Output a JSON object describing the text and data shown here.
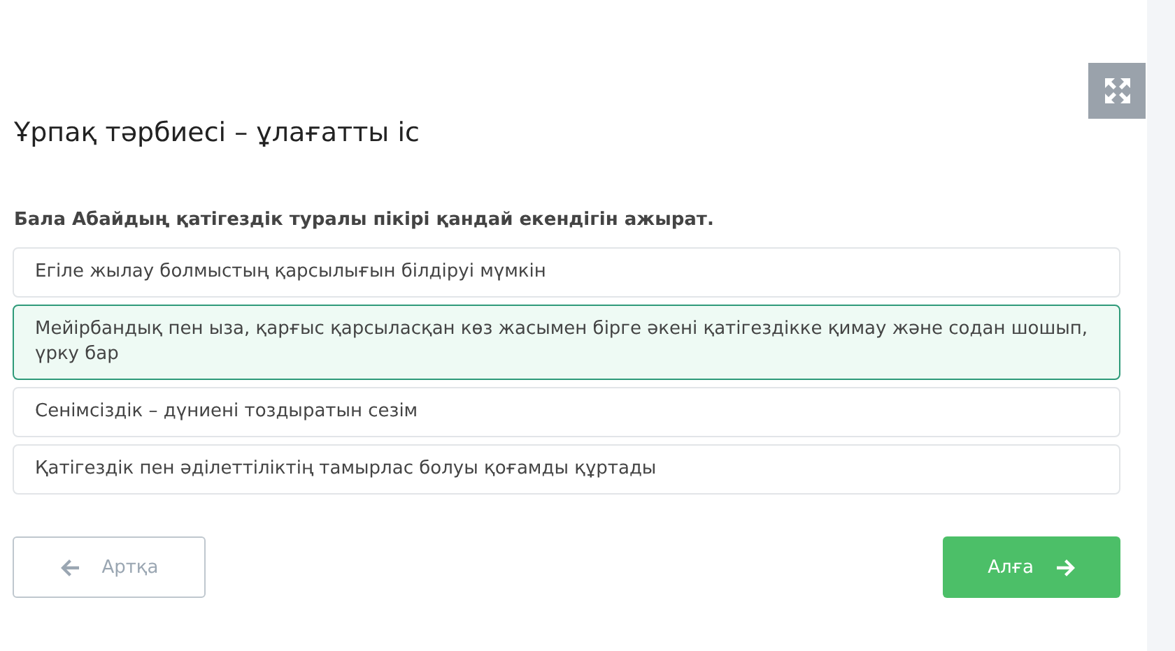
{
  "title": "Ұрпақ тәрбиесі – ұлағатты іс",
  "question": "Бала Абайдың қатігездік туралы пікірі қандай екендігін ажырат.",
  "options": [
    {
      "text": "Егіле жылау болмыстың қарсылығын білдіруі мүмкін",
      "selected": false
    },
    {
      "text": "Мейірбандық пен ыза, қарғыс қарсыласқан көз жасымен бірге әкені қатігездікке қимау және содан шошып, үрку бар",
      "selected": true
    },
    {
      "text": "Сенімсіздік – дүниені тоздыратын сезім",
      "selected": false
    },
    {
      "text": "Қатігездік пен әділеттіліктің тамырлас болуы қоғамды құртады",
      "selected": false
    }
  ],
  "back_button": {
    "label": "Артқа",
    "disabled": true
  },
  "next_button": {
    "label": "Алға",
    "disabled": false
  }
}
